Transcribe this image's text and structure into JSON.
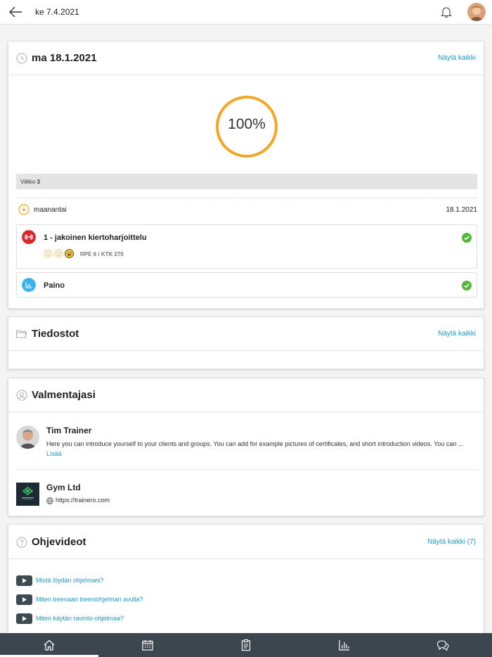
{
  "topbar": {
    "date": "ke 7.4.2021",
    "icons": {
      "back": "arrow-left-icon",
      "notifications": "bell-icon",
      "avatar": "user-avatar"
    }
  },
  "program_card": {
    "date_title": "ma 18.1.2021",
    "show_all": "Näytä kaikki",
    "progress_percent": 100,
    "progress_label": "100%",
    "week_label": "Viikko",
    "week_number": "3",
    "day": {
      "name": "maanantai",
      "date": "18.1.2021"
    },
    "workouts": [
      {
        "title": "1 - jakoinen kiertoharjoittelu",
        "rpe_prefix": "RPE",
        "rpe": "6",
        "ktk_prefix": "KTK",
        "ktk": "270",
        "completed": true,
        "icon": "dumbbell-icon",
        "color": "#d9262a"
      },
      {
        "title": "Paino",
        "completed": true,
        "icon": "chart-icon",
        "color": "#3ab4e8"
      }
    ],
    "moods": [
      "sad-face-icon",
      "neutral-face-icon",
      "happy-face-icon"
    ],
    "accent": "#f5a623",
    "check_color": "#52b837"
  },
  "files_card": {
    "title": "Tiedostot",
    "show_all": "Näytä kaikki"
  },
  "coach_card": {
    "title": "Valmentajasi",
    "coach": {
      "name": "Tim Trainer",
      "bio": "Here you can introduce yourself to your clients and groups. You can add for example pictures of certificates, and short introduction videos. You can ...",
      "more": "Lisää"
    },
    "gym": {
      "name": "Gym Ltd",
      "url": "https://trainero.com",
      "logo_text": "COMPANY NAME"
    }
  },
  "videos_card": {
    "title": "Ohjevideot",
    "show_all": "Näytä kaikki (7)",
    "videos": [
      "Mistä löydän ohjelmani?",
      "Miten treenaan treeniohjelman avulla?",
      "Miten käytän ravinto-ohjelmaa?"
    ]
  },
  "bottom_nav": {
    "items": [
      "home-icon",
      "calendar-icon",
      "clipboard-icon",
      "bar-chart-icon",
      "chat-icon"
    ],
    "active_index": 0
  },
  "colors": {
    "link": "#1a9bc8",
    "nav_bg": "#3b464e"
  }
}
